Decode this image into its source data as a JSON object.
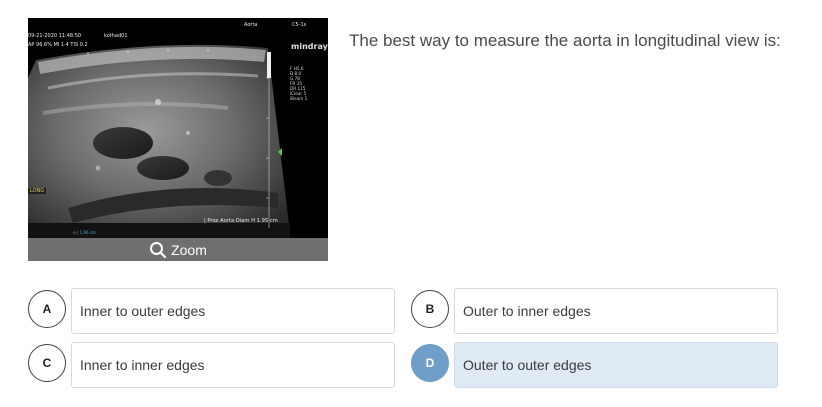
{
  "ultrasound": {
    "timestamp": "09-21-2020 11:48:50",
    "operator": "kothad01",
    "info_line": "AP 96.6% MI 1.4 TIS 0.2",
    "header_label": "Aorta",
    "probe": "C5-1s",
    "brand": "mindray",
    "params": [
      "F H5.6",
      "D 8.0",
      "G 78",
      "FR 35",
      "DR 115",
      "iClear 5",
      "iBeam 1"
    ],
    "orientation_tag": "LONG",
    "measurement": "| Prox Aorta Diam H   1.95 cm",
    "scale_tag": "o-|  1.96 cm",
    "zoom_label": "Zoom"
  },
  "question": {
    "text": "The best way to measure the aorta in longitudinal view is:"
  },
  "options": [
    {
      "letter": "A",
      "text": "Inner to outer edges",
      "selected": false
    },
    {
      "letter": "B",
      "text": "Outer to inner edges",
      "selected": false
    },
    {
      "letter": "C",
      "text": "Inner to inner edges",
      "selected": false
    },
    {
      "letter": "D",
      "text": "Outer to outer edges",
      "selected": true
    }
  ],
  "colors": {
    "selected_circle": "#6f9ec8",
    "selected_box": "#dfeaf4",
    "zoom_bar": "#6f6f6f"
  }
}
